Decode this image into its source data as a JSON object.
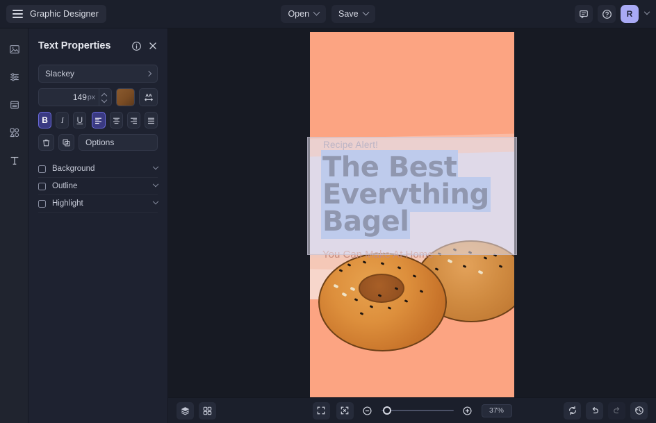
{
  "app": {
    "name": "Graphic Designer",
    "menu_icon": "hamburger-icon"
  },
  "topbar": {
    "open_label": "Open",
    "save_label": "Save",
    "comment_icon": "comment-icon",
    "help_icon": "help-circle-icon",
    "avatar_initial": "R"
  },
  "rail": {
    "items": [
      {
        "name": "images",
        "icon": "image-icon"
      },
      {
        "name": "adjustments",
        "icon": "sliders-icon"
      },
      {
        "name": "pages",
        "icon": "document-icon"
      },
      {
        "name": "elements",
        "icon": "shapes-icon"
      },
      {
        "name": "text",
        "icon": "text-icon"
      }
    ]
  },
  "panel": {
    "title": "Text Properties",
    "info_icon": "info-circle-icon",
    "close_icon": "close-icon",
    "font": {
      "value": "Slackey",
      "chevron": "chevron-right-icon"
    },
    "font_size": {
      "value": "149",
      "unit": "px"
    },
    "color_swatch": "#7a4c24",
    "letter_spacing_icon": "letter-spacing-icon",
    "style_buttons": [
      {
        "name": "bold",
        "label": "B",
        "active": true
      },
      {
        "name": "italic",
        "label": "I",
        "active": false
      },
      {
        "name": "underline",
        "label": "U",
        "active": false
      }
    ],
    "align_buttons": [
      {
        "name": "align-left",
        "active": true
      },
      {
        "name": "align-center",
        "active": false
      },
      {
        "name": "align-right",
        "active": false
      },
      {
        "name": "align-justify",
        "active": false
      }
    ],
    "delete_icon": "trash-icon",
    "duplicate_icon": "duplicate-icon",
    "options_label": "Options",
    "toggles": [
      {
        "label": "Background",
        "checked": false
      },
      {
        "label": "Outline",
        "checked": false
      },
      {
        "label": "Highlight",
        "checked": false
      }
    ]
  },
  "canvas": {
    "kicker": "Recipe Alert!",
    "headline_line1": "The Best",
    "headline_line2": "Everything",
    "headline_line3": "Bagel",
    "subline": "You Can Make At Home",
    "bg_color": "#fca482",
    "band_color": "#dcd3e2",
    "headline_color": "#2e4064",
    "highlight_color": "#93b4ec"
  },
  "bottombar": {
    "layers_icon": "layers-icon",
    "grid_icon": "grid-icon",
    "fit_screen_icon": "fit-screen-icon",
    "fit_selection_icon": "fit-selection-icon",
    "zoom_out_icon": "zoom-out-icon",
    "zoom_in_icon": "zoom-in-icon",
    "zoom_level": "37%",
    "sync_icon": "sync-icon",
    "undo_icon": "undo-icon",
    "redo_icon": "redo-icon",
    "history_icon": "history-icon"
  }
}
